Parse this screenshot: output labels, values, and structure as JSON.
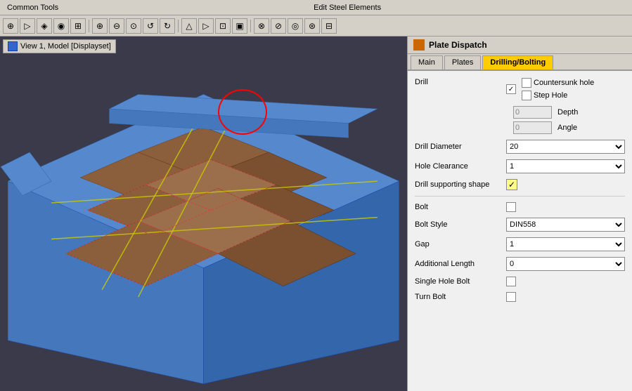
{
  "topbar": {
    "left_label": "Common Tools",
    "center_label": "Edit Steel Elements"
  },
  "viewport": {
    "title": "View 1, Model [Displayset]"
  },
  "panel": {
    "title": "Plate Dispatch",
    "tabs": [
      {
        "label": "Main",
        "active": false
      },
      {
        "label": "Plates",
        "active": false
      },
      {
        "label": "Drilling/Bolting",
        "active": true
      }
    ]
  },
  "drilling_bolting": {
    "drill_label": "Drill",
    "drill_checked": true,
    "countersunk_label": "Countersunk hole",
    "countersunk_checked": false,
    "step_hole_label": "Step Hole",
    "step_hole_checked": false,
    "depth_label": "Depth",
    "depth_value": "0",
    "angle_label": "Angle",
    "angle_value": "0",
    "drill_diameter_label": "Drill Diameter",
    "drill_diameter_value": "20",
    "hole_clearance_label": "Hole Clearance",
    "hole_clearance_value": "1",
    "drill_supporting_label": "Drill supporting shape",
    "drill_supporting_checked": true,
    "bolt_label": "Bolt",
    "bolt_checked": false,
    "bolt_style_label": "Bolt Style",
    "bolt_style_value": "DIN558",
    "gap_label": "Gap",
    "gap_value": "1",
    "additional_length_label": "Additional Length",
    "additional_length_value": "0",
    "single_hole_bolt_label": "Single Hole Bolt",
    "single_hole_bolt_checked": false,
    "turn_bolt_label": "Turn Bolt",
    "turn_bolt_checked": false
  },
  "toolbar_buttons": [
    "⊕",
    "⊖",
    "⊙",
    "⊛",
    "↺",
    "↻",
    "⊞",
    "⊟",
    "△",
    "▷",
    "⊕",
    "🔍",
    "⊡",
    "▣",
    "◈",
    "◉",
    "⊗",
    "⊘"
  ]
}
